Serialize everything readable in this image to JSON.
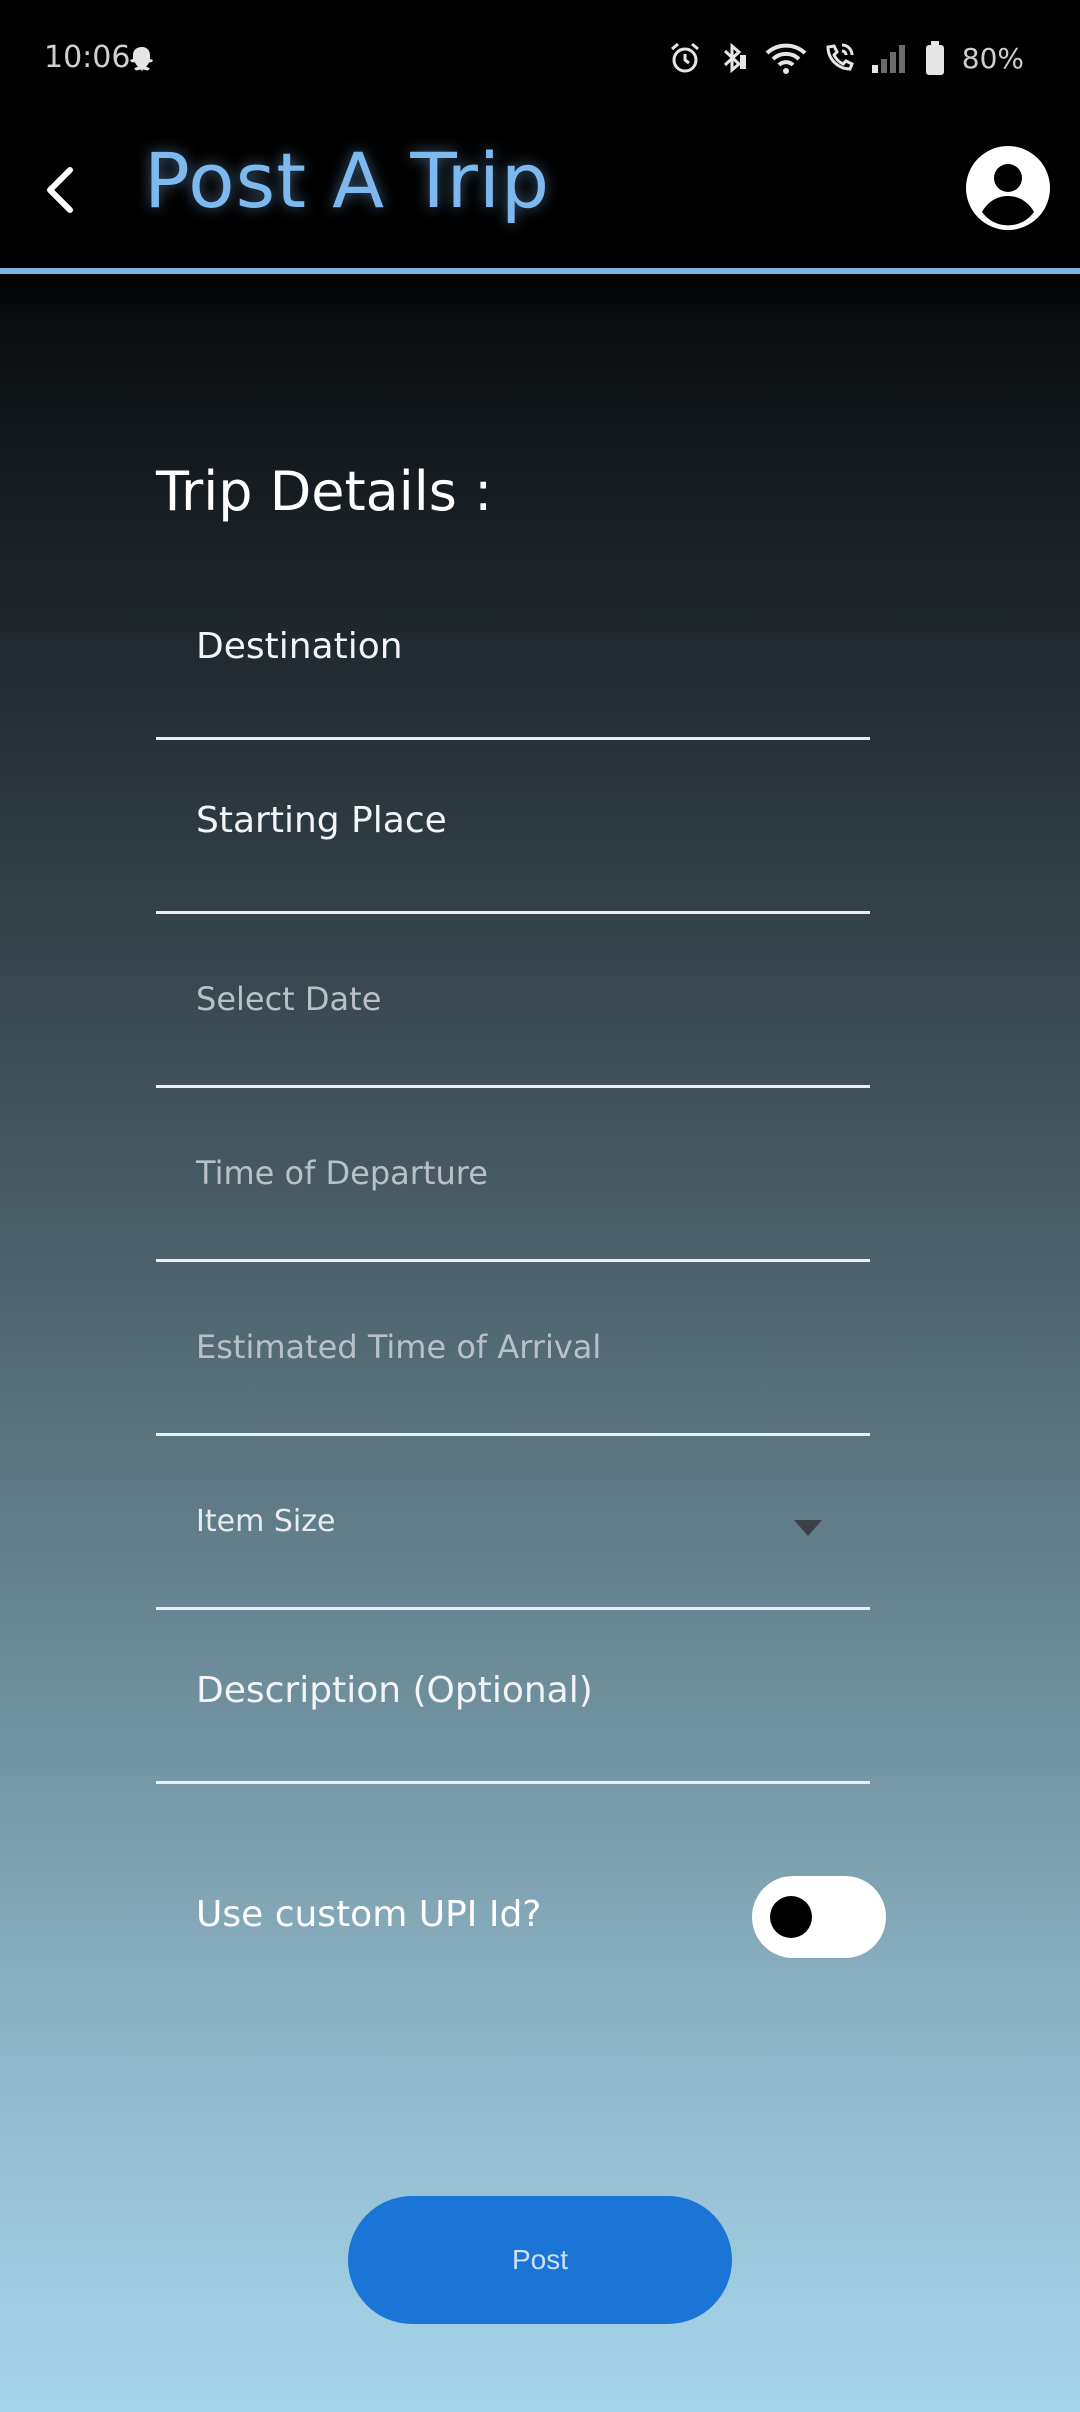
{
  "status_bar": {
    "time": "10:06",
    "battery": "80%",
    "icons": [
      "snapchat-icon",
      "alarm-icon",
      "bluetooth-icon",
      "wifi-icon",
      "wifi-calling-icon",
      "signal-icon",
      "battery-icon"
    ]
  },
  "app_bar": {
    "title": "Post A Trip",
    "back_icon": "chevron-left-icon",
    "profile_icon": "account-circle-icon",
    "accent_color": "#7fb4e6"
  },
  "form": {
    "heading": "Trip Details :",
    "fields": {
      "destination": "Destination",
      "starting_place": "Starting Place",
      "select_date": "Select Date",
      "time_of_departure": "Time of Departure",
      "estimated_arrival": "Estimated Time of Arrival",
      "item_size": "Item Size",
      "description": "Description (Optional)"
    },
    "custom_upi": {
      "label": "Use custom UPI Id?",
      "enabled": false
    },
    "submit_label": "Post",
    "submit_color": "#1a75d6"
  }
}
